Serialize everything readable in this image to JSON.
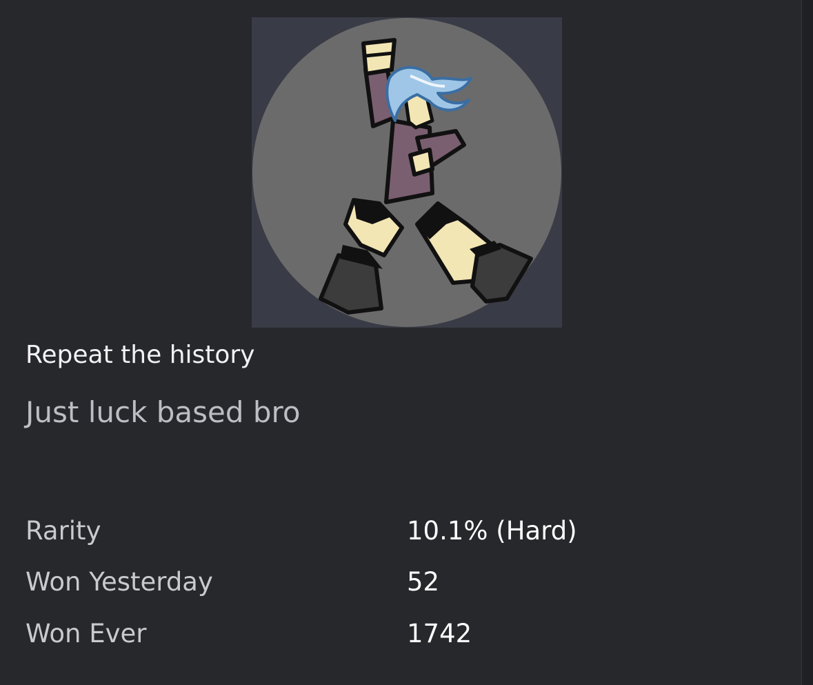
{
  "badge": {
    "image_icon": "badge-character-art",
    "name": "Repeat the history",
    "description": "Just luck based bro"
  },
  "stats": [
    {
      "label": "Rarity",
      "value": "10.1% (Hard)"
    },
    {
      "label": "Won Yesterday",
      "value": "52"
    },
    {
      "label": "Won Ever",
      "value": "1742"
    }
  ],
  "colors": {
    "background": "#27282c",
    "image_background": "#393b46",
    "circle": "#6b6b6b",
    "title_text": "#f2f2f4",
    "description_text": "#bdbec3",
    "label_text": "#c9cace",
    "value_text": "#ffffff"
  }
}
